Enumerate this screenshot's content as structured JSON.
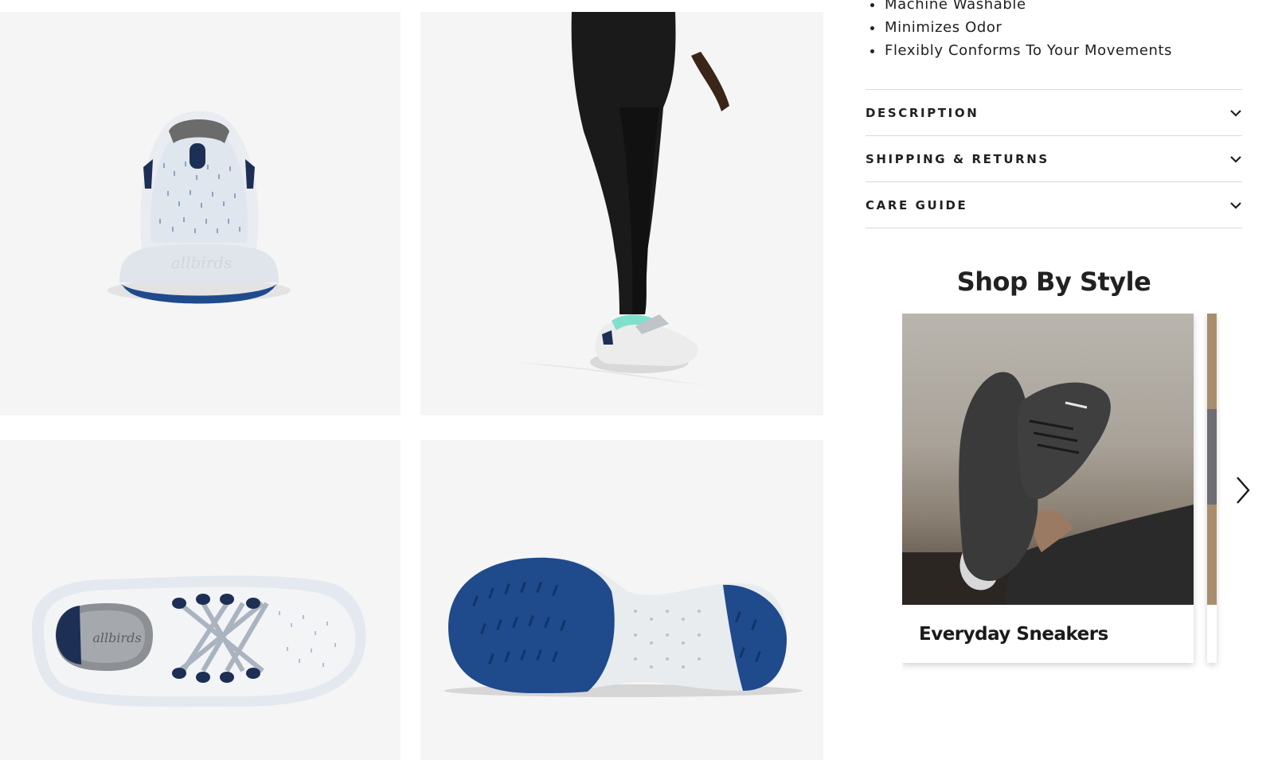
{
  "features": [
    "Machine Washable",
    "Minimizes Odor",
    "Flexibly Conforms To Your Movements"
  ],
  "accordion": [
    {
      "label": "DESCRIPTION",
      "icon": "chevron-down-icon"
    },
    {
      "label": "SHIPPING & RETURNS",
      "icon": "chevron-down-icon"
    },
    {
      "label": "CARE GUIDE",
      "icon": "chevron-down-icon"
    }
  ],
  "shop_by_style": {
    "title": "Shop By Style",
    "cards": [
      {
        "label": "Everyday Sneakers"
      }
    ],
    "next_icon": "chevron-right-icon"
  },
  "gallery": {
    "images": [
      "shoe-heel-view",
      "model-wearing-shoe",
      "shoe-top-view",
      "shoe-sole-view"
    ],
    "brand_mark": "allbirds"
  },
  "colors": {
    "tile_bg": "#f5f5f5",
    "sole_navy": "#1f4a8c",
    "text": "#212121",
    "divider": "#d9d9d9"
  }
}
